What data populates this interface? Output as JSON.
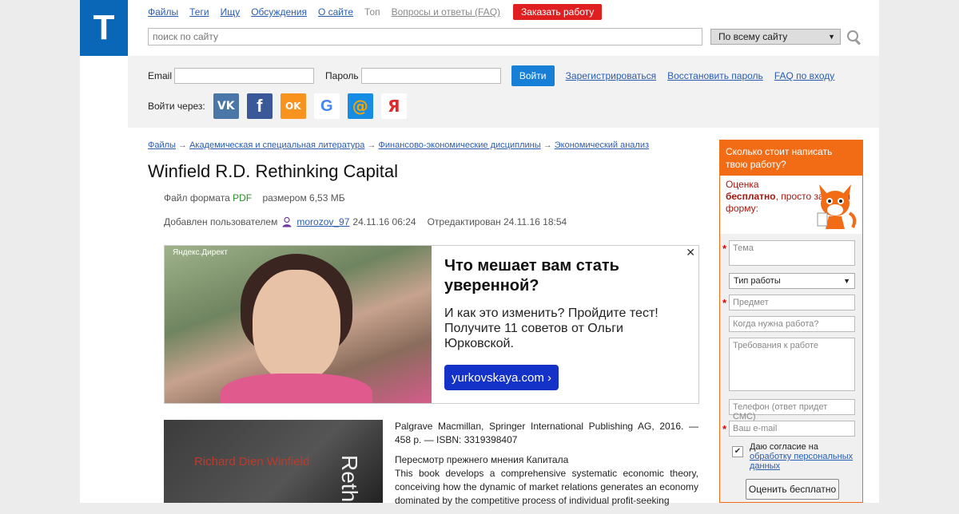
{
  "logo": {
    "letter": "T"
  },
  "nav": {
    "files": "Файлы",
    "tags": "Теги",
    "searching": "Ищу",
    "discussions": "Обсуждения",
    "about": "О сайте",
    "top": "Топ",
    "faq": "Вопросы и ответы (FAQ)",
    "order": "Заказать работу"
  },
  "search": {
    "placeholder": "поиск по сайту",
    "scope": "По всему сайту"
  },
  "login": {
    "email_label": "Email",
    "password_label": "Пароль",
    "button": "Войти",
    "register": "Зарегистрироваться",
    "restore": "Восстановить пароль",
    "faq": "FAQ по входу",
    "via_label": "Войти через:",
    "socials": [
      {
        "name": "vk",
        "glyph": "VK",
        "color": "#4a76a8"
      },
      {
        "name": "facebook",
        "glyph": "f",
        "color": "#3b5998"
      },
      {
        "name": "odnoklassniki",
        "glyph": "OK",
        "color": "#f7931e"
      },
      {
        "name": "google",
        "glyph": "G",
        "color": "#ffffff"
      },
      {
        "name": "mailru",
        "glyph": "@",
        "color": "#168de2"
      },
      {
        "name": "yandex",
        "glyph": "Я",
        "color": "#ffffff"
      }
    ]
  },
  "breadcrumb": {
    "b1": "Файлы",
    "b2": "Академическая и специальная литература",
    "b3": "Финансово-экономические дисциплины",
    "b4": "Экономический анализ",
    "sep": "→"
  },
  "doc": {
    "title": "Winfield R.D. Rethinking Capital",
    "format_prefix": "Файл формата",
    "format": "PDF",
    "size": "размером 6,53 МБ",
    "added_prefix": "Добавлен пользователем",
    "user": "morozov_97",
    "added_date": "24.11.16 06:24",
    "edited": "Отредактирован 24.11.16 18:54"
  },
  "ad": {
    "tag": "Яндекс.Директ",
    "close": "✕",
    "headline": "Что мешает вам стать уверенной?",
    "body": "И как это изменить? Пройдите тест! Получите 11 советов от Ольги Юрковской.",
    "button": "yurkovskaya.com ›"
  },
  "book": {
    "cover_author": "Richard Dien Winfield",
    "cover_title": "Reth",
    "publisher": "Palgrave Macmillan, Springer International Publishing AG, 2016. — 458 р. — ISBN: 3319398407",
    "subtitle": "Пересмотр прежнего мнения Капитала",
    "abstract": "This book develops a comprehensive systematic economic theory, conceiving how the dynamic of market relations generates an economy dominated by the competitive process of individual profit-seeking"
  },
  "sidebar": {
    "header": "Сколько стоит написать твою работу?",
    "intro_1": "Оценка",
    "intro_bold": "бесплатно",
    "intro_2": ", просто заполни форму:",
    "topic": "Тема",
    "work_type": "Тип работы",
    "subject": "Предмет",
    "deadline": "Когда нужна работа?",
    "requirements": "Требования к работе",
    "phone": "Телефон (ответ придет СМС)",
    "email": "Ваш e-mail",
    "consent_text": "Даю согласие на",
    "consent_link": "обработку персональных данных",
    "submit": "Оценить бесплатно",
    "required_mark": "*"
  }
}
